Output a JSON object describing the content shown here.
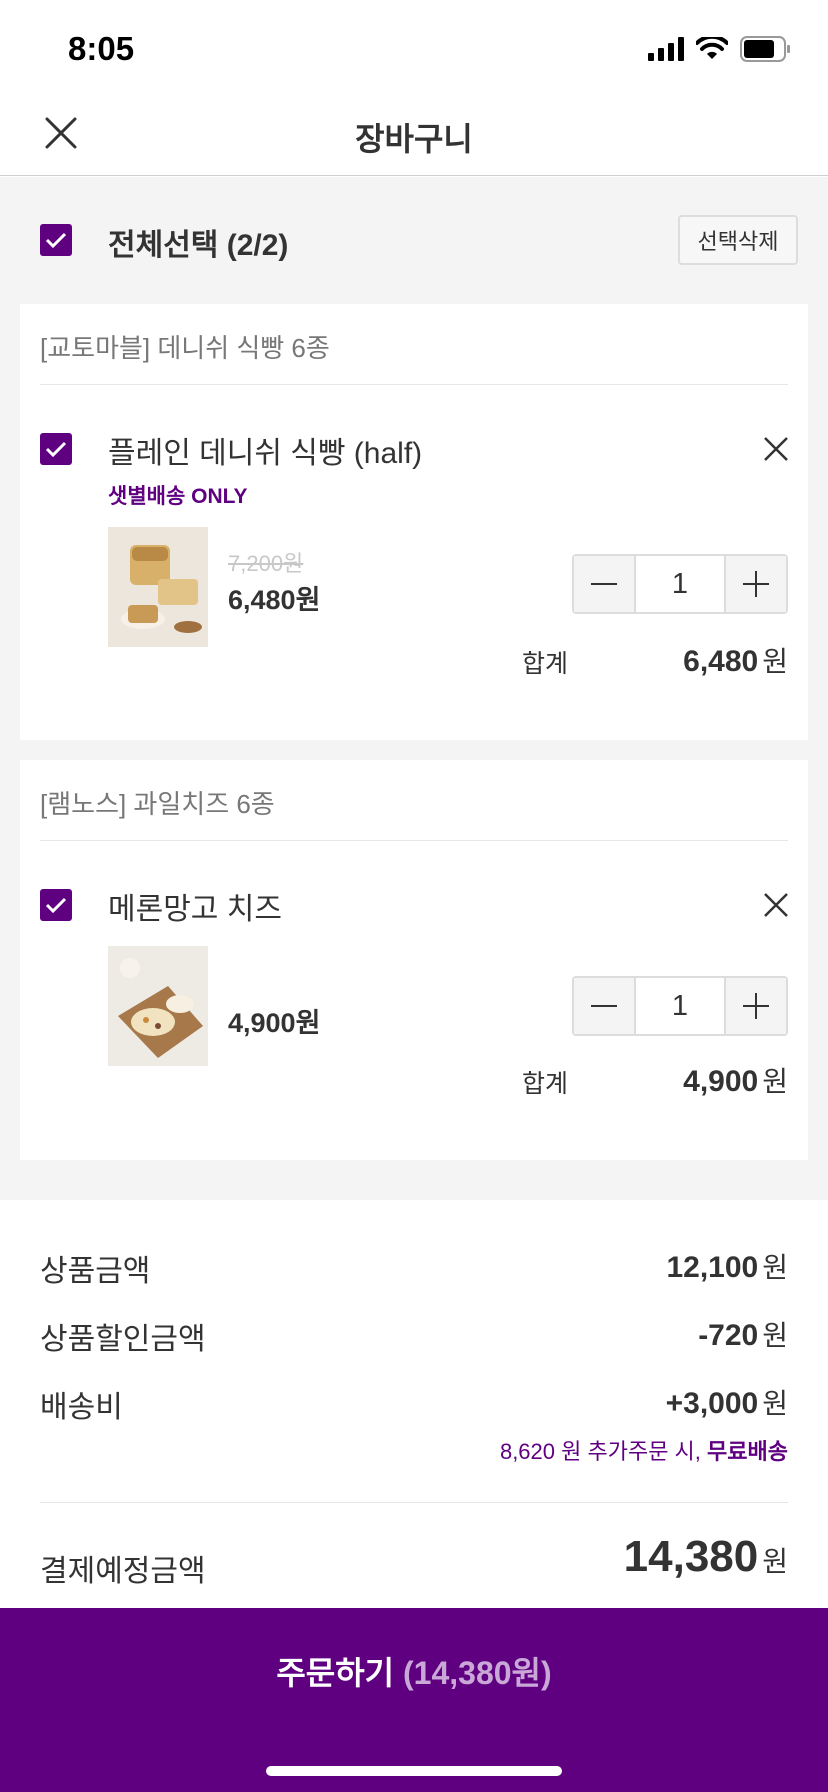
{
  "status_bar": {
    "time": "8:05"
  },
  "nav": {
    "title": "장바구니"
  },
  "select_all": {
    "label": "전체선택 (2/2)",
    "delete_label": "선택삭제"
  },
  "vendors": [
    {
      "name": "[교토마블] 데니쉬 식빵 6종",
      "item": {
        "name": "플레인 데니쉬 식빵 (half)",
        "tag": "샛별배송 ONLY",
        "original_price": "7,200원",
        "price": "6,480원",
        "quantity": "1",
        "sum_label": "합계",
        "sum_value": "6,480",
        "sum_unit": "원"
      }
    },
    {
      "name": "[램노스] 과일치즈 6종",
      "item": {
        "name": "메론망고 치즈",
        "price": "4,900원",
        "quantity": "1",
        "sum_label": "합계",
        "sum_value": "4,900",
        "sum_unit": "원"
      }
    }
  ],
  "summary": {
    "product_amount_label": "상품금액",
    "product_amount": "12,100",
    "discount_label": "상품할인금액",
    "discount": "-720",
    "shipping_label": "배송비",
    "shipping": "+3,000",
    "unit": "원",
    "free_ship_prefix": "8,620 원 추가주문 시,",
    "free_ship_bold": "무료배송",
    "total_label": "결제예정금액",
    "total": "14,380"
  },
  "order": {
    "label": "주문하기",
    "amount": "(14,380원)"
  },
  "colors": {
    "accent": "#5f0080",
    "background": "#f4f4f4"
  }
}
